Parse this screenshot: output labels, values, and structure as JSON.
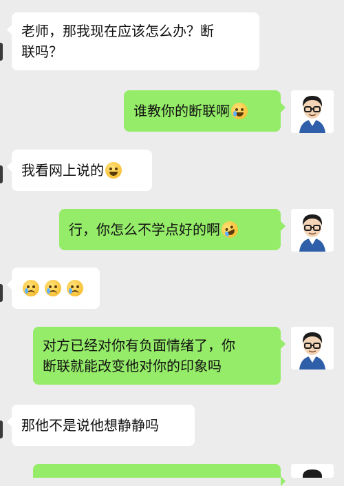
{
  "messages": [
    {
      "side": "left",
      "lines": [
        "老师，那我现在应该怎么办？断",
        "联吗？"
      ]
    },
    {
      "side": "right",
      "text": "谁教你的断联啊",
      "emoji": "laughing-tears"
    },
    {
      "side": "left",
      "text": "我看网上说的",
      "emoji": "grinning"
    },
    {
      "side": "right",
      "text": "行，你怎么不学点好的啊",
      "emoji": "rolling-laughing"
    },
    {
      "side": "left",
      "text": "",
      "emojis": [
        "crying",
        "crying",
        "crying"
      ]
    },
    {
      "side": "right",
      "lines": [
        "对方已经对你有负面情绪了，你",
        "断联就能改变他对你的印象吗"
      ]
    },
    {
      "side": "left",
      "text": "那他不是说他想静静吗"
    },
    {
      "side": "right",
      "text": ""
    }
  ],
  "colors": {
    "background": "#ececec",
    "incoming": "#ffffff",
    "outgoing": "#95ec69"
  }
}
